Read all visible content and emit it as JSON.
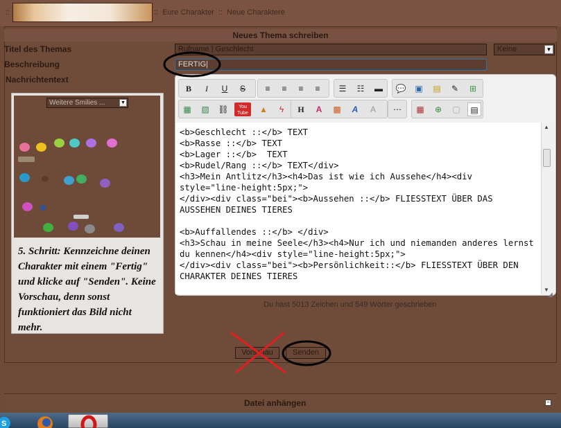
{
  "breadcrumb": {
    "prefix": "::",
    "logo_text": "",
    "sep": "::",
    "items": [
      "Eure Charakter",
      "Neue Charaktere"
    ]
  },
  "form": {
    "header": "Neues Thema schreiben",
    "title_label": "Titel des Themas",
    "title_value": "Rufname | Geschlecht",
    "title_select": "Keine",
    "desc_label": "Beschreibung",
    "desc_value": "FERTIG|",
    "msg_label": "Nachrichtentext"
  },
  "smilies": {
    "select_label": "Weitere Smilies ..."
  },
  "instructions": "5. Schritt: Kennzeichne deinen Charakter mit einem \"Fertig\" und klicke auf \"Senden\". Keine Vorschau, denn sonst funktioniert das Bild nicht mehr.",
  "toolbar": {
    "bold": "B",
    "italic": "I",
    "underline": "U",
    "strike": "S",
    "heading": "H"
  },
  "editor": {
    "lines": [
      "<b>Geschlecht ::</b> TEXT",
      "<b>Rasse ::</b> TEXT",
      "<b>Lager ::</b>  TEXT",
      "<b>Rudel/Rang ::</b> TEXT</div>",
      "<h3>Mein Antlitz</h3><h4>Das ist wie ich Aussehe</h4><div style=\"line-height:5px;\">",
      "</div><div class=\"bei\"><b>Aussehen ::</b> FLIESSTEXT ÜBER DAS AUSSEHEN DEINES TIERES",
      "",
      "<b>Auffallendes ::</b> </div>",
      "<h3>Schau in meine Seele</h3><h4>Nur ich und niemanden anderes lernst du kennen</h4><div style=\"line-height:5px;\">",
      "</div><div class=\"bei\"><b>Persönlichkeit::</b> FLIESSTEXT ÜBER DEN CHARAKTER DEINES TIERES"
    ]
  },
  "counter": "Du hast 5013 Zeichen und 549 Wörter geschrieben",
  "buttons": {
    "preview": "Vorschau",
    "send": "Senden"
  },
  "attach": {
    "label": "Datei anhängen",
    "toggle": "−"
  },
  "colors": {
    "background": "#6e4a38",
    "annotation_circle": "#000000",
    "annotation_cross": "#e02020"
  }
}
